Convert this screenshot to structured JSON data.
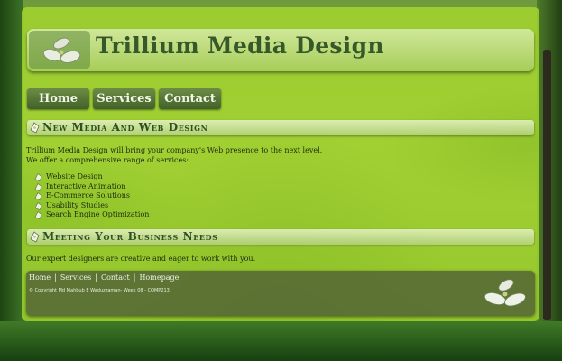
{
  "header": {
    "title": "Trillium Media Design"
  },
  "nav": {
    "items": [
      "Home",
      "Services",
      "Contact"
    ]
  },
  "sections": [
    {
      "title": "New Media And Web Design",
      "intro_line1": "Trillium Media Design will bring your company's Web presence to the next level.",
      "intro_line2": "We offer a comprehensive range of services:",
      "services": [
        "Website Design",
        "Interactive Animation",
        "E-Commerce Solutions",
        "Usability Studies",
        "Search Engine Optimization"
      ]
    },
    {
      "title": "Meeting Your Business Needs",
      "text": "Our expert designers are creative and eager to work with you."
    }
  ],
  "footer": {
    "links": [
      "Home",
      "Services",
      "Contact",
      "Homepage"
    ],
    "separator": "|",
    "copyright": "© Copyright Md Mahbub E Waduzzaman- Week 08 - COMP213"
  },
  "colors": {
    "page_bg": "#a5d72d",
    "nav_button": "#4f6f33",
    "title_text": "#37592a"
  },
  "icons": {
    "logo": "trillium-flower-icon",
    "section_bullet": "trillium-bullet-icon"
  }
}
